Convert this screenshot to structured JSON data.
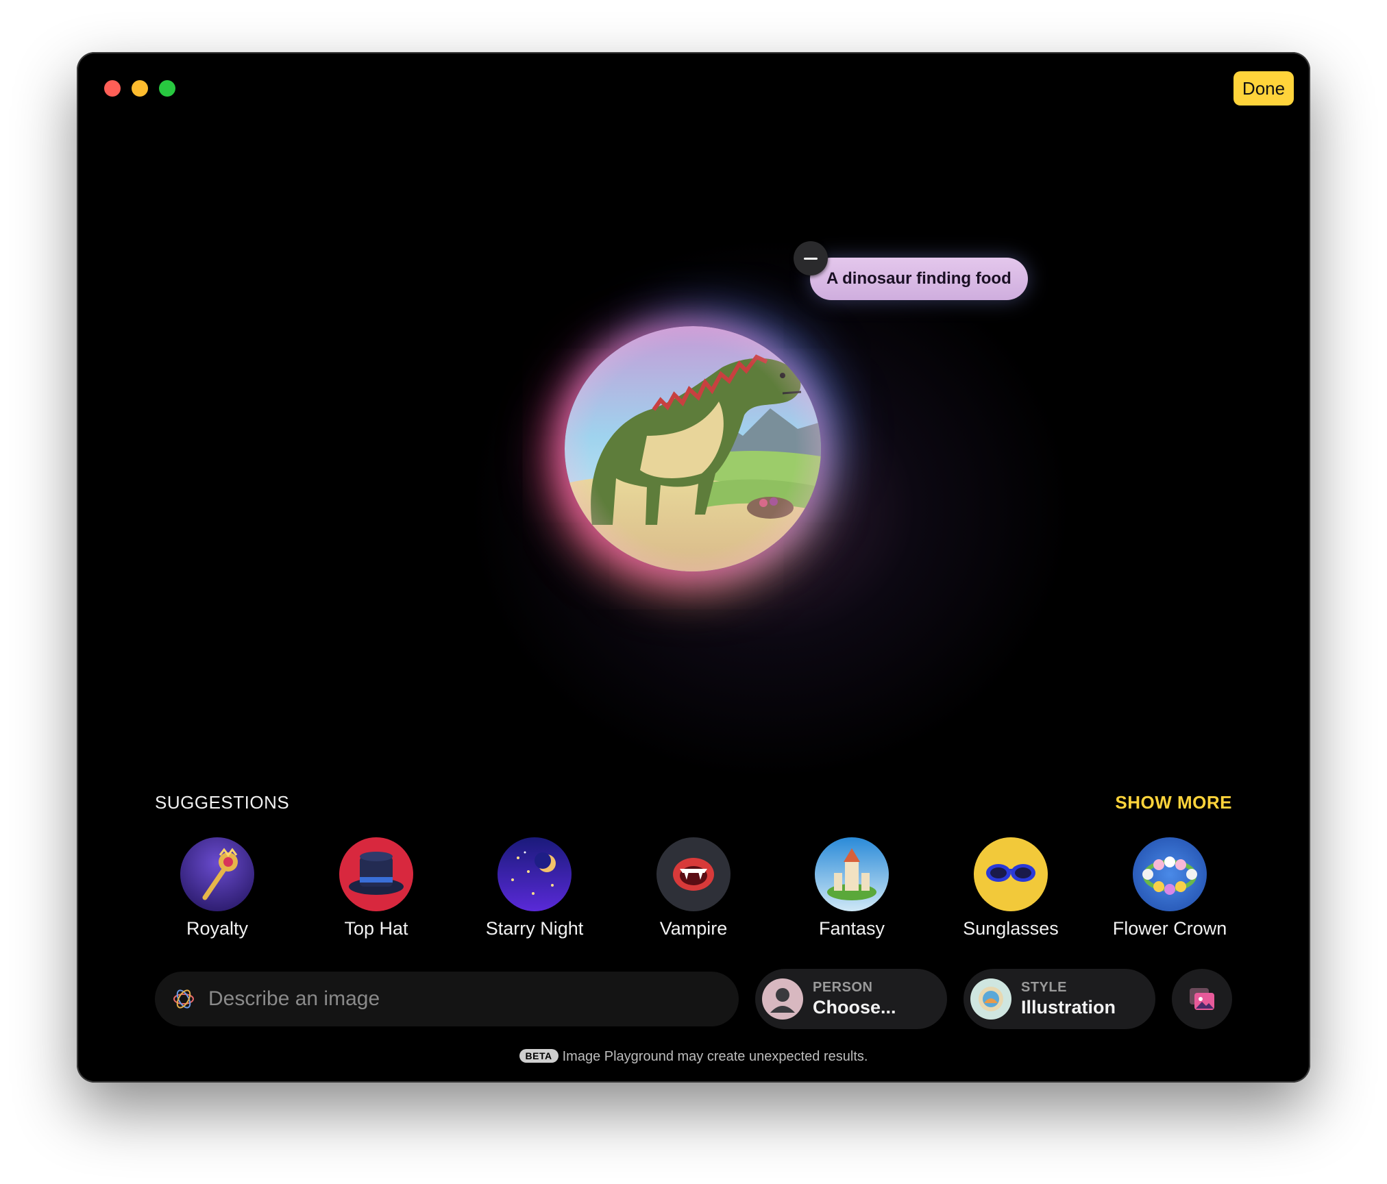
{
  "window": {
    "done_label": "Done"
  },
  "prompt_chip": {
    "text": "A dinosaur finding food"
  },
  "suggestions": {
    "section_label": "SUGGESTIONS",
    "show_more_label": "SHOW MORE",
    "items": [
      {
        "label": "Royalty",
        "icon": "scepter-icon"
      },
      {
        "label": "Top Hat",
        "icon": "top-hat-icon"
      },
      {
        "label": "Starry Night",
        "icon": "starry-night-icon"
      },
      {
        "label": "Vampire",
        "icon": "vampire-mouth-icon"
      },
      {
        "label": "Fantasy",
        "icon": "castle-island-icon"
      },
      {
        "label": "Sunglasses",
        "icon": "sunglasses-icon"
      },
      {
        "label": "Flower Crown",
        "icon": "flower-crown-icon"
      }
    ]
  },
  "input": {
    "placeholder": "Describe an image",
    "value": ""
  },
  "person": {
    "label": "PERSON",
    "value": "Choose..."
  },
  "style": {
    "label": "STYLE",
    "value": "Illustration"
  },
  "footer": {
    "badge": "BETA",
    "text": "Image Playground may create unexpected results."
  },
  "colors": {
    "accent": "#ffd43b",
    "background": "#000000",
    "chip": "#d9bce6"
  }
}
